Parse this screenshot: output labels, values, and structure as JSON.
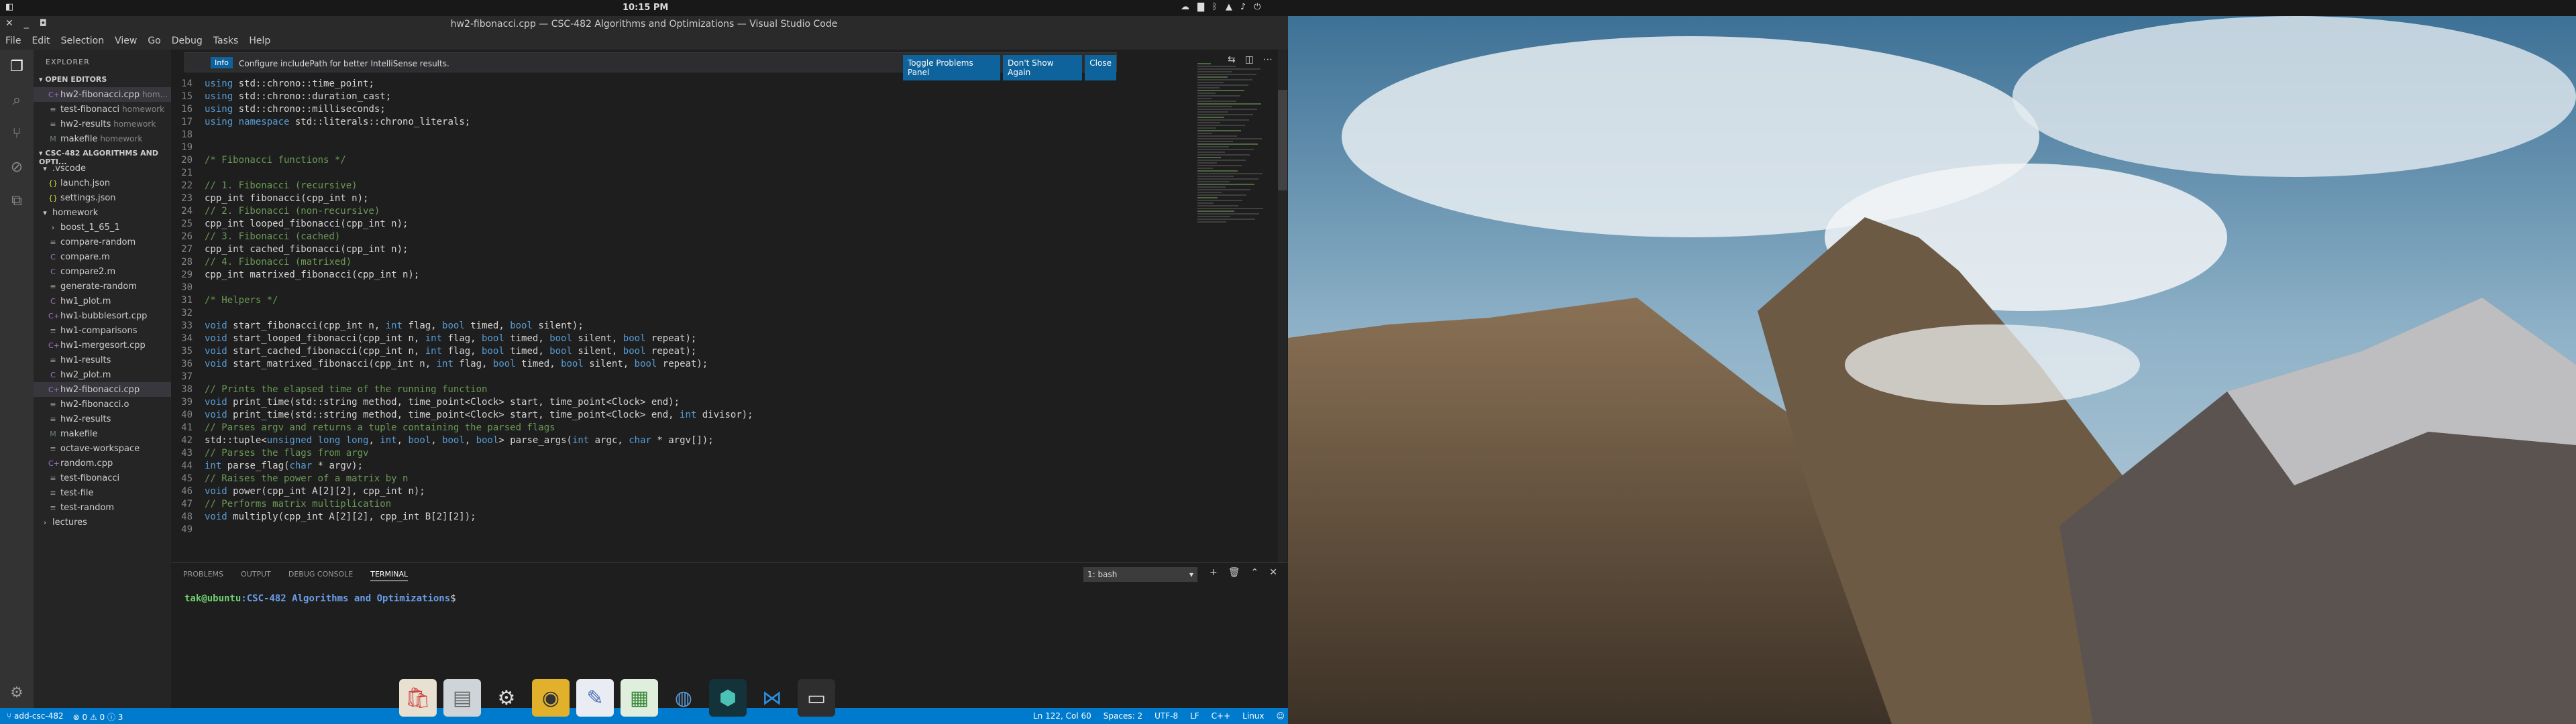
{
  "top": {
    "clock": "10:15 PM"
  },
  "window": {
    "title": "hw2-fibonacci.cpp — CSC-482 Algorithms and Optimizations — Visual Studio Code"
  },
  "menu": [
    "File",
    "Edit",
    "Selection",
    "View",
    "Go",
    "Debug",
    "Tasks",
    "Help"
  ],
  "sidebar": {
    "header": "EXPLORER",
    "open_editors_title": "OPEN EDITORS",
    "open_editors": [
      {
        "name": "hw2-fibonacci.cpp",
        "hint": "hom...",
        "icon": "C+",
        "selected": true
      },
      {
        "name": "test-fibonacci",
        "hint": "homework",
        "icon": "≡"
      },
      {
        "name": "hw2-results",
        "hint": "homework",
        "icon": "≡"
      },
      {
        "name": "makefile",
        "hint": "homework",
        "icon": "M"
      }
    ],
    "project_title": "CSC-482 ALGORITHMS AND OPTI...",
    "files": [
      {
        "name": ".vscode",
        "icon": "▾",
        "depth": 0
      },
      {
        "name": "launch.json",
        "icon": "{}",
        "depth": 1
      },
      {
        "name": "settings.json",
        "icon": "{}",
        "depth": 1
      },
      {
        "name": "homework",
        "icon": "▾",
        "depth": 0
      },
      {
        "name": "boost_1_65_1",
        "icon": "›",
        "depth": 1
      },
      {
        "name": "compare-random",
        "icon": "≡",
        "depth": 1
      },
      {
        "name": "compare.m",
        "icon": "C",
        "depth": 1
      },
      {
        "name": "compare2.m",
        "icon": "C",
        "depth": 1
      },
      {
        "name": "generate-random",
        "icon": "≡",
        "depth": 1
      },
      {
        "name": "hw1_plot.m",
        "icon": "C",
        "depth": 1
      },
      {
        "name": "hw1-bubblesort.cpp",
        "icon": "C+",
        "depth": 1
      },
      {
        "name": "hw1-comparisons",
        "icon": "≡",
        "depth": 1
      },
      {
        "name": "hw1-mergesort.cpp",
        "icon": "C+",
        "depth": 1
      },
      {
        "name": "hw1-results",
        "icon": "≡",
        "depth": 1
      },
      {
        "name": "hw2_plot.m",
        "icon": "C",
        "depth": 1
      },
      {
        "name": "hw2-fibonacci.cpp",
        "icon": "C+",
        "depth": 1,
        "selected": true
      },
      {
        "name": "hw2-fibonacci.o",
        "icon": "≡",
        "depth": 1
      },
      {
        "name": "hw2-results",
        "icon": "≡",
        "depth": 1
      },
      {
        "name": "makefile",
        "icon": "M",
        "depth": 1
      },
      {
        "name": "octave-workspace",
        "icon": "≡",
        "depth": 1
      },
      {
        "name": "random.cpp",
        "icon": "C+",
        "depth": 1
      },
      {
        "name": "test-fibonacci",
        "icon": "≡",
        "depth": 1
      },
      {
        "name": "test-file",
        "icon": "≡",
        "depth": 1
      },
      {
        "name": "test-random",
        "icon": "≡",
        "depth": 1
      },
      {
        "name": "lectures",
        "icon": "›",
        "depth": 0
      }
    ]
  },
  "info": {
    "badge": "Info",
    "message": "Configure includePath for better IntelliSense results.",
    "buttons": [
      "Toggle Problems Panel",
      "Don't Show Again",
      "Close"
    ]
  },
  "code": [
    {
      "n": "14",
      "t": "using std::chrono::time_point;",
      "c": "kw"
    },
    {
      "n": "15",
      "t": "using std::chrono::duration_cast;",
      "c": "kw"
    },
    {
      "n": "16",
      "t": "using std::chrono::milliseconds;",
      "c": "kw"
    },
    {
      "n": "17",
      "t": "using namespace std::literals::chrono_literals;",
      "c": "kw"
    },
    {
      "n": "18",
      "t": "",
      "c": ""
    },
    {
      "n": "19",
      "t": "",
      "c": ""
    },
    {
      "n": "20",
      "t": "/* Fibonacci functions */",
      "c": "cm"
    },
    {
      "n": "21",
      "t": "",
      "c": ""
    },
    {
      "n": "22",
      "t": "// 1. Fibonacci (recursive)",
      "c": "cm"
    },
    {
      "n": "23",
      "t": "cpp_int fibonacci(cpp_int n);",
      "c": ""
    },
    {
      "n": "24",
      "t": "// 2. Fibonacci (non-recursive)",
      "c": "cm"
    },
    {
      "n": "25",
      "t": "cpp_int looped_fibonacci(cpp_int n);",
      "c": ""
    },
    {
      "n": "26",
      "t": "// 3. Fibonacci (cached)",
      "c": "cm"
    },
    {
      "n": "27",
      "t": "cpp_int cached_fibonacci(cpp_int n);",
      "c": ""
    },
    {
      "n": "28",
      "t": "// 4. Fibonacci (matrixed)",
      "c": "cm"
    },
    {
      "n": "29",
      "t": "cpp_int matrixed_fibonacci(cpp_int n);",
      "c": ""
    },
    {
      "n": "30",
      "t": "",
      "c": ""
    },
    {
      "n": "31",
      "t": "/* Helpers */",
      "c": "cm"
    },
    {
      "n": "32",
      "t": "",
      "c": ""
    },
    {
      "n": "33",
      "t": "void start_fibonacci(cpp_int n, int flag, bool timed, bool silent);",
      "c": ""
    },
    {
      "n": "34",
      "t": "void start_looped_fibonacci(cpp_int n, int flag, bool timed, bool silent, bool repeat);",
      "c": ""
    },
    {
      "n": "35",
      "t": "void start_cached_fibonacci(cpp_int n, int flag, bool timed, bool silent, bool repeat);",
      "c": ""
    },
    {
      "n": "36",
      "t": "void start_matrixed_fibonacci(cpp_int n, int flag, bool timed, bool silent, bool repeat);",
      "c": ""
    },
    {
      "n": "37",
      "t": "",
      "c": ""
    },
    {
      "n": "38",
      "t": "// Prints the elapsed time of the running function",
      "c": "cm"
    },
    {
      "n": "39",
      "t": "void print_time(std::string method, time_point<Clock> start, time_point<Clock> end);",
      "c": ""
    },
    {
      "n": "40",
      "t": "void print_time(std::string method, time_point<Clock> start, time_point<Clock> end, int divisor);",
      "c": ""
    },
    {
      "n": "41",
      "t": "// Parses argv and returns a tuple containing the parsed flags",
      "c": "cm"
    },
    {
      "n": "42",
      "t": "std::tuple<unsigned long long, int, bool, bool, bool> parse_args(int argc, char * argv[]);",
      "c": ""
    },
    {
      "n": "43",
      "t": "// Parses the flags from argv",
      "c": "cm"
    },
    {
      "n": "44",
      "t": "int parse_flag(char * argv);",
      "c": ""
    },
    {
      "n": "45",
      "t": "// Raises the power of a matrix by n",
      "c": "cm"
    },
    {
      "n": "46",
      "t": "void power(cpp_int A[2][2], cpp_int n);",
      "c": ""
    },
    {
      "n": "47",
      "t": "// Performs matrix multiplication",
      "c": "cm"
    },
    {
      "n": "48",
      "t": "void multiply(cpp_int A[2][2], cpp_int B[2][2]);",
      "c": ""
    },
    {
      "n": "49",
      "t": "",
      "c": ""
    }
  ],
  "panel": {
    "tabs": [
      "PROBLEMS",
      "OUTPUT",
      "DEBUG CONSOLE",
      "TERMINAL"
    ],
    "terminal_select": "1: bash",
    "prompt_user": "tak@ubuntu",
    "prompt_path": ":CSC-482 Algorithms and Optimizations",
    "prompt_end": "$"
  },
  "status": {
    "branch": "add-csc-482",
    "problems": "⊗ 0 ⚠ 0 ⓘ 3",
    "position": "Ln 122, Col 60",
    "spaces": "Spaces: 2",
    "encoding": "UTF-8",
    "eol": "LF",
    "lang": "C++",
    "os": "Linux"
  }
}
